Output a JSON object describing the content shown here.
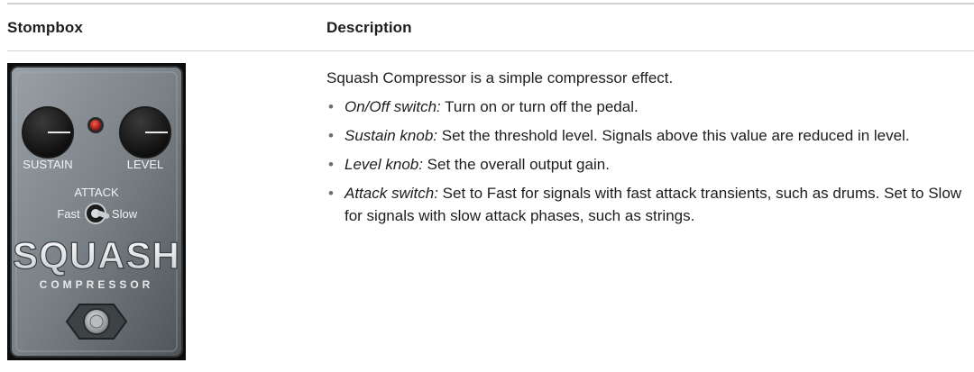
{
  "table": {
    "headers": {
      "col1": "Stompbox",
      "col2": "Description"
    },
    "pedal": {
      "knob_left_label": "SUSTAIN",
      "knob_right_label": "LEVEL",
      "attack_label": "ATTACK",
      "fast_label": "Fast",
      "slow_label": "Slow",
      "brand": "SQUASH",
      "subbrand": "COMPRESSOR"
    },
    "description": {
      "intro": "Squash Compressor is a simple compressor effect.",
      "items": [
        {
          "term": "On/Off switch:",
          "text": " Turn on or turn off the pedal."
        },
        {
          "term": "Sustain knob:",
          "text": " Set the threshold level. Signals above this value are reduced in level."
        },
        {
          "term": "Level knob:",
          "text": " Set the overall output gain."
        },
        {
          "term": "Attack switch:",
          "text": " Set to Fast for signals with fast attack transients, such as drums. Set to Slow for signals with slow attack phases, such as strings."
        }
      ]
    }
  }
}
